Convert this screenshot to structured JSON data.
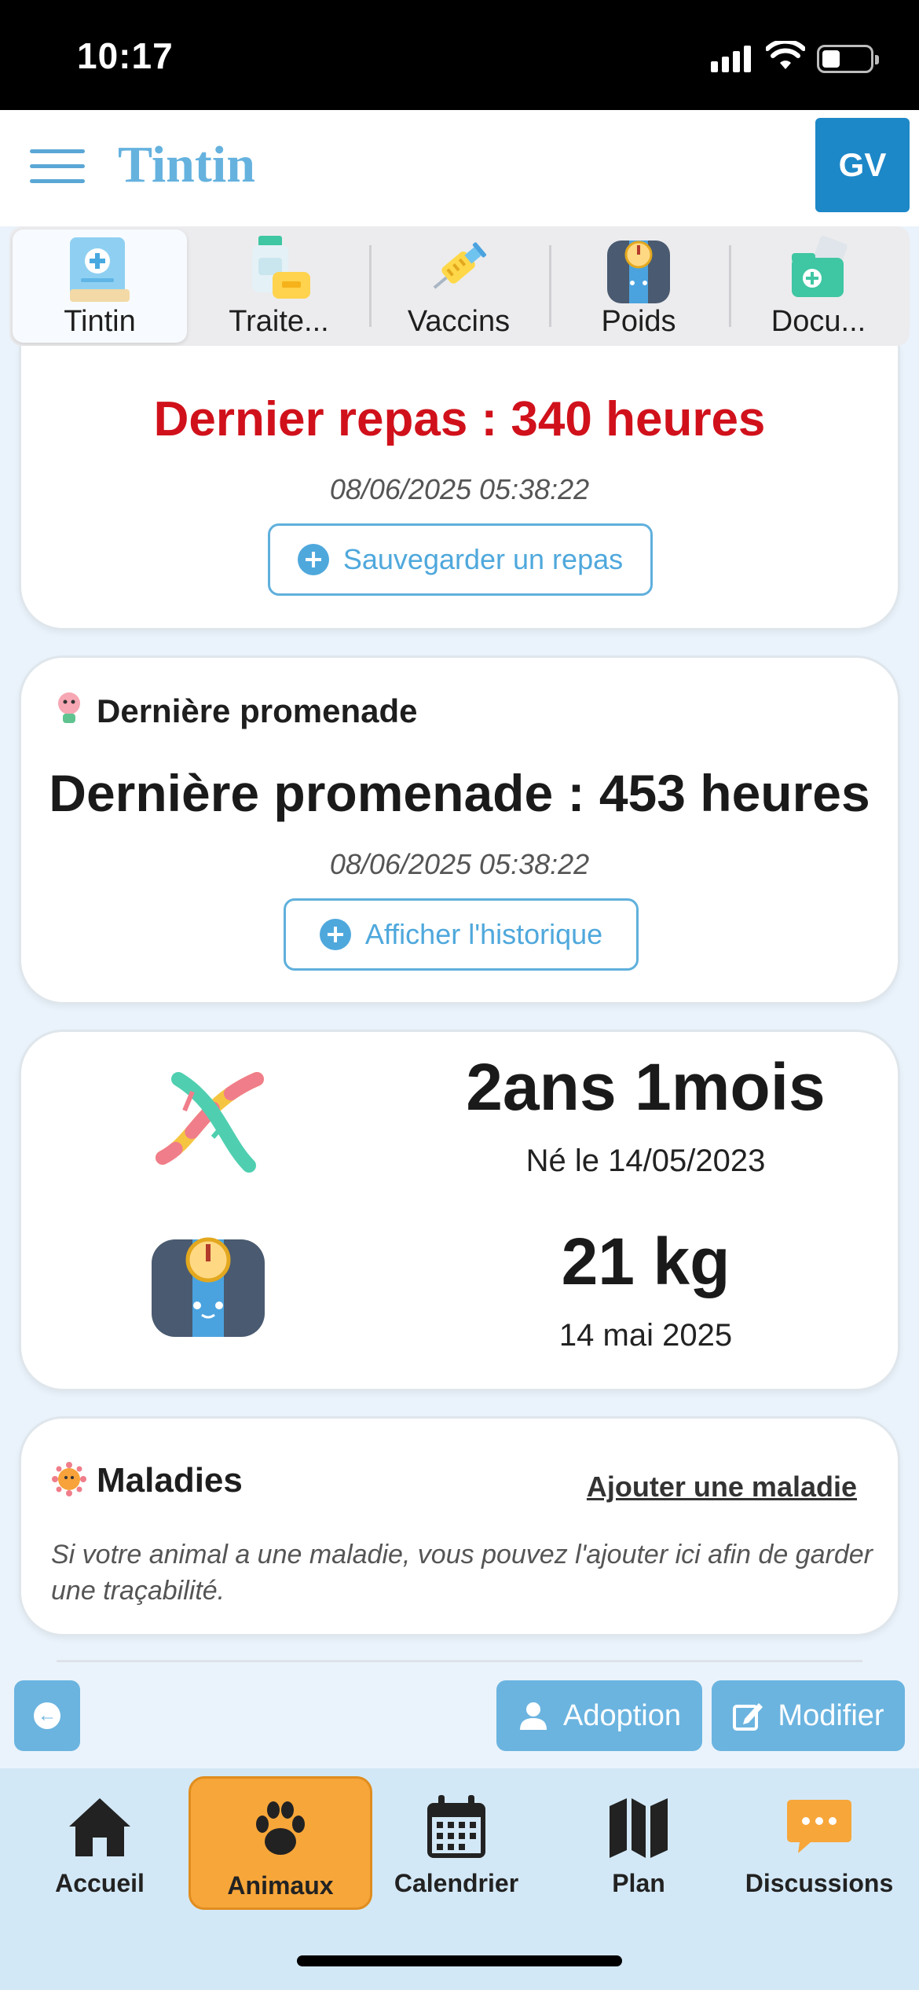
{
  "status_bar": {
    "time": "10:17"
  },
  "header": {
    "title": "Tintin",
    "avatar_initials": "GV"
  },
  "tabs": [
    {
      "label": "Tintin",
      "icon": "health-book-icon",
      "active": true
    },
    {
      "label": "Traite...",
      "icon": "medicine-icon",
      "active": false
    },
    {
      "label": "Vaccins",
      "icon": "syringe-icon",
      "active": false
    },
    {
      "label": "Poids",
      "icon": "scale-icon",
      "active": false
    },
    {
      "label": "Docu...",
      "icon": "medical-folder-icon",
      "active": false
    }
  ],
  "meal_card": {
    "headline": "Dernier repas : 340 heures",
    "timestamp": "08/06/2025 05:38:22",
    "button_label": "Sauvegarder un repas"
  },
  "walk_card": {
    "section_title": "Dernière promenade",
    "headline": "Dernière promenade : 453 heures",
    "timestamp": "08/06/2025 05:38:22",
    "button_label": "Afficher l'historique"
  },
  "info_card": {
    "age": "2ans 1mois",
    "birth": "Né le 14/05/2023",
    "weight": "21 kg",
    "weight_date": "14 mai 2025"
  },
  "diseases_card": {
    "title": "Maladies",
    "add_link": "Ajouter une maladie",
    "description": "Si votre animal a une maladie, vous pouvez l'ajouter ici afin de garder une traçabilité."
  },
  "actions": {
    "adoption_label": "Adoption",
    "edit_label": "Modifier"
  },
  "bottom_nav": [
    {
      "label": "Accueil",
      "icon": "home-icon"
    },
    {
      "label": "Animaux",
      "icon": "paw-icon",
      "active": true
    },
    {
      "label": "Calendrier",
      "icon": "calendar-icon"
    },
    {
      "label": "Plan",
      "icon": "map-icon"
    },
    {
      "label": "Discussions",
      "icon": "chat-icon"
    }
  ],
  "colors": {
    "accent": "#4fa8dc",
    "alert_red": "#d0111b",
    "nav_active": "#f7a63a",
    "avatar_bg": "#1d88c8"
  }
}
